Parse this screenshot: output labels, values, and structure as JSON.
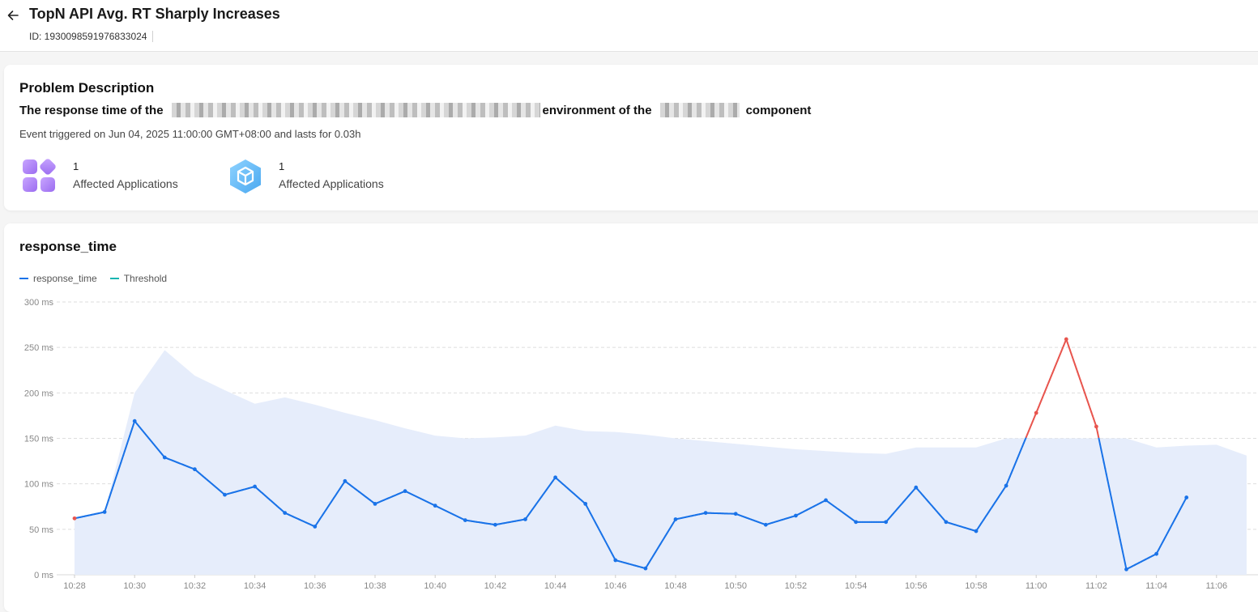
{
  "header": {
    "title": "TopN API Avg. RT Sharply Increases",
    "event_id": "ID: 1930098591976833024"
  },
  "problem": {
    "heading": "Problem Description",
    "desc_part1": "The response time of the",
    "desc_part2": "environment of the",
    "desc_part3": "component",
    "event_info": "Event triggered on Jun 04, 2025 11:00:00 GMT+08:00 and lasts for 0.03h",
    "stats": [
      {
        "count": "1",
        "label": "Affected Applications",
        "icon": "apps-grid-icon"
      },
      {
        "count": "1",
        "label": "Affected Applications",
        "icon": "cube-icon"
      }
    ]
  },
  "chart_section": {
    "title": "response_time"
  },
  "colors": {
    "series": "#1a73e8",
    "anomaly": "#e8554e",
    "threshold": "#13b5b1",
    "band": "#e6edfb"
  },
  "chart_data": {
    "type": "line",
    "y_unit": "ms",
    "ylim": [
      0,
      300
    ],
    "y_ticks": [
      0,
      50,
      100,
      150,
      200,
      250,
      300
    ],
    "y_tick_labels": [
      "0 ms",
      "50 ms",
      "100 ms",
      "150 ms",
      "200 ms",
      "250 ms",
      "300 ms"
    ],
    "x": [
      "10:28",
      "10:29",
      "10:30",
      "10:31",
      "10:32",
      "10:33",
      "10:34",
      "10:35",
      "10:36",
      "10:37",
      "10:38",
      "10:39",
      "10:40",
      "10:41",
      "10:42",
      "10:43",
      "10:44",
      "10:45",
      "10:46",
      "10:47",
      "10:48",
      "10:49",
      "10:50",
      "10:51",
      "10:52",
      "10:53",
      "10:54",
      "10:55",
      "10:56",
      "10:57",
      "10:58",
      "10:59",
      "11:00",
      "11:01",
      "11:02",
      "11:03",
      "11:04",
      "11:05",
      "11:06",
      "11:07"
    ],
    "x_tick_labels": [
      "10:28",
      "10:30",
      "10:32",
      "10:34",
      "10:36",
      "10:38",
      "10:40",
      "10:42",
      "10:44",
      "10:46",
      "10:48",
      "10:50",
      "10:52",
      "10:54",
      "10:56",
      "10:58",
      "11:00",
      "11:02",
      "11:04",
      "11:06"
    ],
    "legend": [
      "response_time",
      "Threshold"
    ],
    "legend_position": "top-left",
    "grid": true,
    "series": [
      {
        "name": "response_time",
        "values": [
          62,
          69,
          169,
          129,
          116,
          88,
          97,
          68,
          53,
          103,
          78,
          92,
          76,
          60,
          55,
          61,
          107,
          78,
          16,
          7,
          61,
          68,
          67,
          55,
          65,
          82,
          58,
          58,
          96,
          58,
          48,
          98,
          178,
          259,
          163,
          6,
          23,
          85,
          null,
          null
        ],
        "anomaly_indices": [
          0,
          32,
          33,
          34
        ]
      },
      {
        "name": "Threshold",
        "values": [
          62,
          69,
          200,
          247,
          219,
          203,
          188,
          195,
          187,
          178,
          170,
          161,
          153,
          150,
          151,
          153,
          164,
          158,
          157,
          154,
          150,
          147,
          144,
          141,
          138,
          136,
          134,
          133,
          140,
          140,
          140,
          150,
          150,
          150,
          150,
          150,
          140,
          142,
          143,
          131
        ]
      }
    ]
  }
}
